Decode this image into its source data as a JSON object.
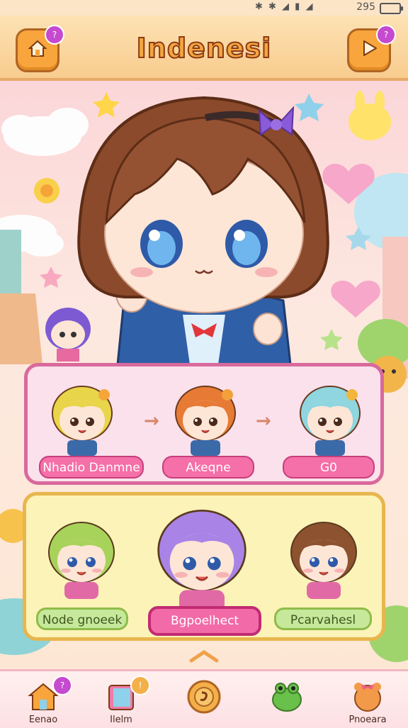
{
  "status_bar": {
    "time": "295",
    "signal_glyphs": "✱ ✱ ◢ ▮ ◢"
  },
  "header": {
    "title": "Indenesi",
    "home_badge": "?",
    "play_badge": "?"
  },
  "evolution_panel": {
    "stages": [
      {
        "label": "Nhadio Danmne",
        "hair": "#e9d54a",
        "acc": "#f4a63b"
      },
      {
        "label": "Akeqne",
        "hair": "#e77a34",
        "acc": "#f2a03c"
      },
      {
        "label": "G0",
        "hair": "#8fd6e0",
        "acc": "#f2b63c"
      }
    ]
  },
  "choose_panel": {
    "characters": [
      {
        "label": "Node gnoeek",
        "hair": "#a8d35a",
        "selected": false
      },
      {
        "label": "Bgpoelhect",
        "hair": "#a984e6",
        "selected": true
      },
      {
        "label": "Pcarvahesl",
        "hair": "#8d5230",
        "selected": false
      }
    ]
  },
  "bottom_nav": {
    "items": [
      {
        "label": "Eenao",
        "icon": "house-icon",
        "badge": "?"
      },
      {
        "label": "Ilelm",
        "icon": "book-icon",
        "badge": "!"
      },
      {
        "label": "",
        "icon": "coin-icon",
        "badge": ""
      },
      {
        "label": "",
        "icon": "frog-icon",
        "badge": ""
      },
      {
        "label": "Pnoeara",
        "icon": "bear-icon",
        "badge": ""
      }
    ]
  },
  "colors": {
    "accent_orange": "#f7a53c",
    "accent_pink": "#f56fa8",
    "accent_purple": "#c54ad0",
    "panel_green": "#c6e89a"
  }
}
